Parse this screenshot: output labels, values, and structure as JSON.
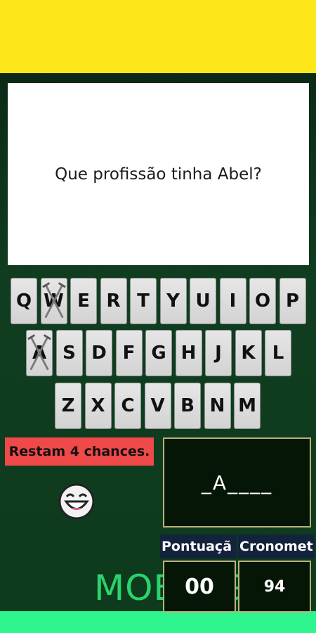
{
  "question": {
    "text": "Que profissão tinha Abel?"
  },
  "keyboard": {
    "row1": [
      "Q",
      "W",
      "E",
      "R",
      "T",
      "Y",
      "U",
      "I",
      "O",
      "P"
    ],
    "row2": [
      "A",
      "S",
      "D",
      "F",
      "G",
      "H",
      "J",
      "K",
      "L"
    ],
    "row3": [
      "Z",
      "X",
      "C",
      "V",
      "B",
      "N",
      "M"
    ],
    "used_keys": [
      "W",
      "A"
    ]
  },
  "status": {
    "chances_text": "Restam 4 chances."
  },
  "word": {
    "display": "_A____"
  },
  "score": {
    "label": "Pontuaçã",
    "value": "00"
  },
  "timer": {
    "label": "Cronomet",
    "value": "94"
  },
  "branding": {
    "logo_text": "MOBJOG"
  },
  "colors": {
    "top_bar": "#fde71b",
    "bottom_bar": "#2ff58e",
    "chances_bg": "#f04949",
    "logo": "#29d46c"
  },
  "icons": {
    "smiley": "smiley-face-icon",
    "used_key_mark": "crossed-swords-icon"
  }
}
